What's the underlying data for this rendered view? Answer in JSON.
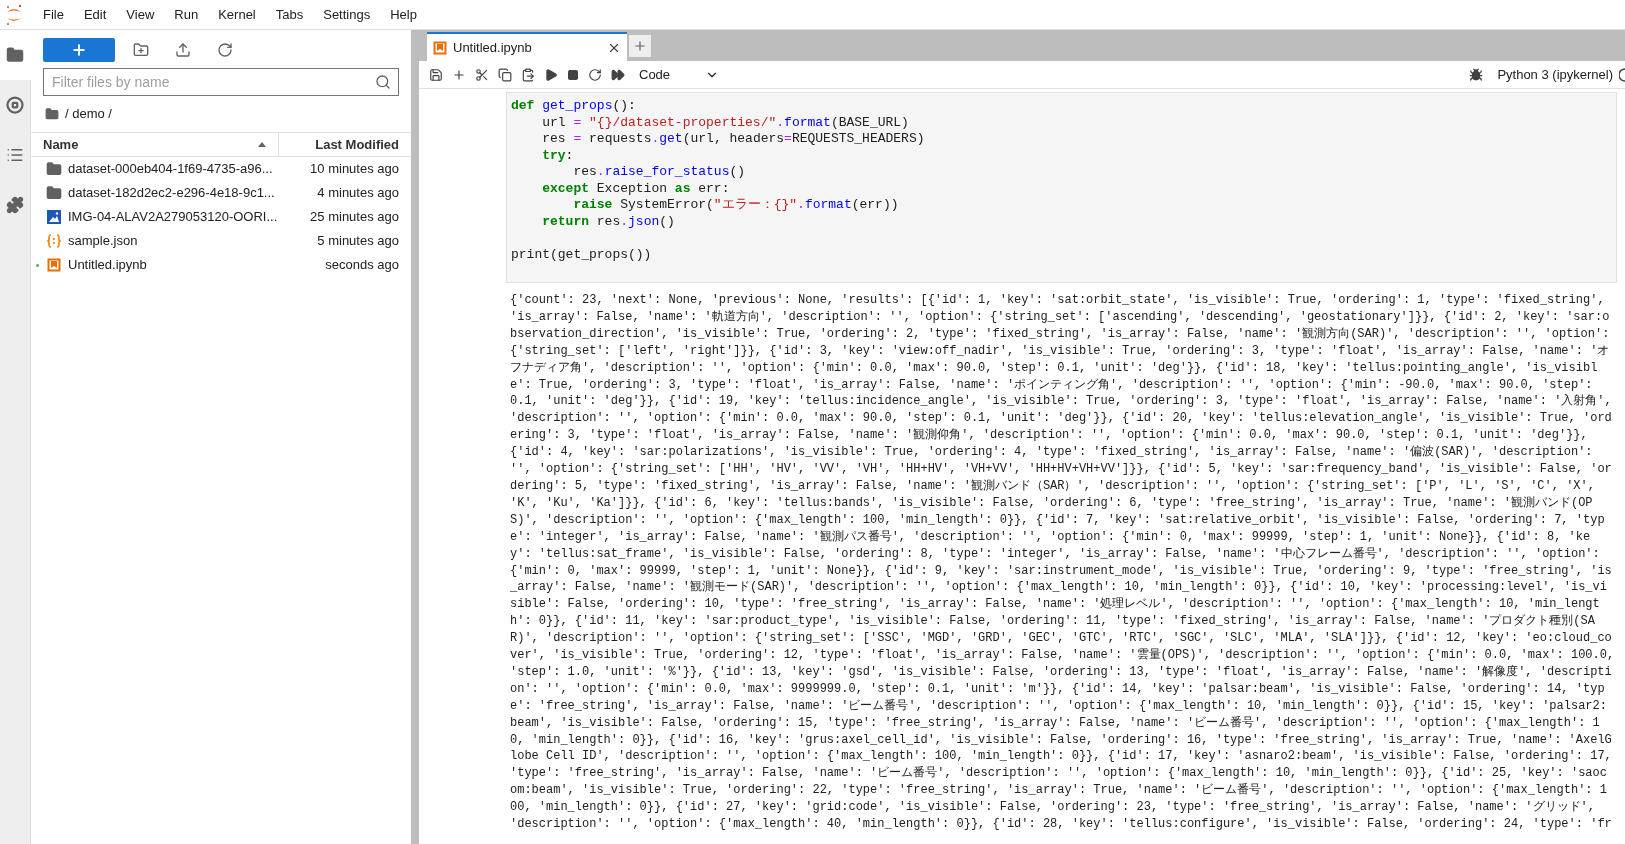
{
  "menu": [
    "File",
    "Edit",
    "View",
    "Run",
    "Kernel",
    "Tabs",
    "Settings",
    "Help"
  ],
  "file_browser": {
    "filter_placeholder": "Filter files by name",
    "breadcrumb": "/ demo /",
    "columns": [
      "Name",
      "Last Modified"
    ],
    "files": [
      {
        "name": "dataset-000eb404-1f69-4735-a96...",
        "modified": "10 minutes ago",
        "kind": "folder",
        "running": false
      },
      {
        "name": "dataset-182d2ec2-e296-4e18-9c1...",
        "modified": "4 minutes ago",
        "kind": "folder",
        "running": false
      },
      {
        "name": "IMG-04-ALAV2A279053120-OORI...",
        "modified": "25 minutes ago",
        "kind": "image",
        "running": false
      },
      {
        "name": "sample.json",
        "modified": "5 minutes ago",
        "kind": "json",
        "running": false
      },
      {
        "name": "Untitled.ipynb",
        "modified": "seconds ago",
        "kind": "notebook",
        "running": true
      }
    ]
  },
  "notebook": {
    "tab": {
      "title": "Untitled.ipynb"
    },
    "cell_type": "Code",
    "kernel": "Python 3 (ipykernel)",
    "code_blocks": [
      [
        [
          {
            "text": "def ",
            "kind": "keyword"
          },
          {
            "text": "get_props",
            "kind": "function"
          },
          {
            "text": "():",
            "kind": "plain"
          }
        ],
        [
          {
            "text": "    url ",
            "kind": "plain"
          },
          {
            "text": "= ",
            "kind": "operator"
          },
          {
            "text": "\"{}/dataset-properties/\"",
            "kind": "string"
          },
          {
            "text": ".",
            "kind": "operator"
          },
          {
            "text": "format",
            "kind": "function"
          },
          {
            "text": "(BASE_URL)",
            "kind": "plain"
          }
        ],
        [
          {
            "text": "    res ",
            "kind": "plain"
          },
          {
            "text": "=",
            "kind": "operator"
          },
          {
            "text": " requests",
            "kind": "plain"
          },
          {
            "text": ".",
            "kind": "operator"
          },
          {
            "text": "get",
            "kind": "function"
          },
          {
            "text": "(url, headers",
            "kind": "plain"
          },
          {
            "text": "=",
            "kind": "operator"
          },
          {
            "text": "REQUESTS_HEADERS)",
            "kind": "plain"
          }
        ],
        [
          {
            "text": "    try",
            "kind": "keyword"
          },
          {
            "text": ":",
            "kind": "plain"
          }
        ],
        [
          {
            "text": "        res",
            "kind": "plain"
          },
          {
            "text": ".",
            "kind": "operator"
          },
          {
            "text": "raise_for_status",
            "kind": "function"
          },
          {
            "text": "()",
            "kind": "plain"
          }
        ],
        [
          {
            "text": "    except",
            "kind": "keyword"
          },
          {
            "text": " Exception ",
            "kind": "plain"
          },
          {
            "text": "as",
            "kind": "keyword"
          },
          {
            "text": " err:",
            "kind": "plain"
          }
        ],
        [
          {
            "text": "        raise",
            "kind": "keyword"
          },
          {
            "text": " SystemError(",
            "kind": "plain"
          },
          {
            "text": "\"エラー：{}\"",
            "kind": "string"
          },
          {
            "text": ".",
            "kind": "operator"
          },
          {
            "text": "format",
            "kind": "function"
          },
          {
            "text": "(err))",
            "kind": "plain"
          }
        ],
        [
          {
            "text": "    return",
            "kind": "keyword"
          },
          {
            "text": " res",
            "kind": "plain"
          },
          {
            "text": ".",
            "kind": "operator"
          },
          {
            "text": "json",
            "kind": "function"
          },
          {
            "text": "()",
            "kind": "plain"
          }
        ]
      ],
      [
        [
          {
            "text": "print(get_props())",
            "kind": "plain"
          }
        ]
      ]
    ],
    "output": [
      "{'count': 23, 'next': None, 'previous': None, 'results': [{'id': 1, 'key': 'sat:orbit_state', 'is_visible': True, 'ordering': 1, 'type': 'fixed_string',",
      "'is_array': False, 'name': '軌道方向', 'description': '', 'option': {'string_set': ['ascending', 'descending', 'geostationary']}}, {'id': 2, 'key': 'sar:o",
      "bservation_direction', 'is_visible': True, 'ordering': 2, 'type': 'fixed_string', 'is_array': False, 'name': '観測方向(SAR)', 'description': '', 'option':",
      "{'string_set': ['left', 'right']}}, {'id': 3, 'key': 'view:off_nadir', 'is_visible': True, 'ordering': 3, 'type': 'float', 'is_array': False, 'name': 'オ",
      "フナディア角', 'description': '', 'option': {'min': 0.0, 'max': 90.0, 'step': 0.1, 'unit': 'deg'}}, {'id': 18, 'key': 'tellus:pointing_angle', 'is_visibl",
      "e': True, 'ordering': 3, 'type': 'float', 'is_array': False, 'name': 'ポインティング角', 'description': '', 'option': {'min': -90.0, 'max': 90.0, 'step':",
      "0.1, 'unit': 'deg'}}, {'id': 19, 'key': 'tellus:incidence_angle', 'is_visible': True, 'ordering': 3, 'type': 'float', 'is_array': False, 'name': '入射角',",
      "'description': '', 'option': {'min': 0.0, 'max': 90.0, 'step': 0.1, 'unit': 'deg'}}, {'id': 20, 'key': 'tellus:elevation_angle', 'is_visible': True, 'ord",
      "ering': 3, 'type': 'float', 'is_array': False, 'name': '観測仰角', 'description': '', 'option': {'min': 0.0, 'max': 90.0, 'step': 0.1, 'unit': 'deg'}},",
      "{'id': 4, 'key': 'sar:polarizations', 'is_visible': True, 'ordering': 4, 'type': 'fixed_string', 'is_array': False, 'name': '偏波(SAR)', 'description':",
      "'', 'option': {'string_set': ['HH', 'HV', 'VV', 'VH', 'HH+HV', 'VH+VV', 'HH+HV+VH+VV']}}, {'id': 5, 'key': 'sar:frequency_band', 'is_visible': False, 'or",
      "dering': 5, 'type': 'fixed_string', 'is_array': False, 'name': '観測バンド（SAR）', 'description': '', 'option': {'string_set': ['P', 'L', 'S', 'C', 'X',",
      "'K', 'Ku', 'Ka']}}, {'id': 6, 'key': 'tellus:bands', 'is_visible': False, 'ordering': 6, 'type': 'free_string', 'is_array': True, 'name': '観測バンド(OP",
      "S)', 'description': '', 'option': {'max_length': 100, 'min_length': 0}}, {'id': 7, 'key': 'sat:relative_orbit', 'is_visible': False, 'ordering': 7, 'typ",
      "e': 'integer', 'is_array': False, 'name': '観測パス番号', 'description': '', 'option': {'min': 0, 'max': 99999, 'step': 1, 'unit': None}}, {'id': 8, 'ke",
      "y': 'tellus:sat_frame', 'is_visible': False, 'ordering': 8, 'type': 'integer', 'is_array': False, 'name': '中心フレーム番号', 'description': '', 'option':",
      "{'min': 0, 'max': 99999, 'step': 1, 'unit': None}}, {'id': 9, 'key': 'sar:instrument_mode', 'is_visible': True, 'ordering': 9, 'type': 'free_string', 'is",
      "_array': False, 'name': '観測モード(SAR)', 'description': '', 'option': {'max_length': 10, 'min_length': 0}}, {'id': 10, 'key': 'processing:level', 'is_vi",
      "sible': False, 'ordering': 10, 'type': 'free_string', 'is_array': False, 'name': '処理レベル', 'description': '', 'option': {'max_length': 10, 'min_lengt",
      "h': 0}}, {'id': 11, 'key': 'sar:product_type', 'is_visible': False, 'ordering': 11, 'type': 'fixed_string', 'is_array': False, 'name': 'プロダクト種別(SA",
      "R)', 'description': '', 'option': {'string_set': ['SSC', 'MGD', 'GRD', 'GEC', 'GTC', 'RTC', 'SGC', 'SLC', 'MLA', 'SLA']}}, {'id': 12, 'key': 'eo:cloud_co",
      "ver', 'is_visible': True, 'ordering': 12, 'type': 'float', 'is_array': False, 'name': '雲量(OPS)', 'description': '', 'option': {'min': 0.0, 'max': 100.0,",
      "'step': 1.0, 'unit': '%'}}, {'id': 13, 'key': 'gsd', 'is_visible': False, 'ordering': 13, 'type': 'float', 'is_array': False, 'name': '解像度', 'descripti",
      "on': '', 'option': {'min': 0.0, 'max': 9999999.0, 'step': 0.1, 'unit': 'm'}}, {'id': 14, 'key': 'palsar:beam', 'is_visible': False, 'ordering': 14, 'typ",
      "e': 'free_string', 'is_array': False, 'name': 'ビーム番号', 'description': '', 'option': {'max_length': 10, 'min_length': 0}}, {'id': 15, 'key': 'palsar2:",
      "beam', 'is_visible': False, 'ordering': 15, 'type': 'free_string', 'is_array': False, 'name': 'ビーム番号', 'description': '', 'option': {'max_length': 1",
      "0, 'min_length': 0}}, {'id': 16, 'key': 'grus:axel_cell_id', 'is_visible': False, 'ordering': 16, 'type': 'free_string', 'is_array': True, 'name': 'AxelG",
      "lobe Cell ID', 'description': '', 'option': {'max_length': 100, 'min_length': 0}}, {'id': 17, 'key': 'asnaro2:beam', 'is_visible': False, 'ordering': 17,",
      "'type': 'free_string', 'is_array': False, 'name': 'ビーム番号', 'description': '', 'option': {'max_length': 10, 'min_length': 0}}, {'id': 25, 'key': 'saoc",
      "om:beam', 'is_visible': True, 'ordering': 22, 'type': 'free_string', 'is_array': True, 'name': 'ビーム番号', 'description': '', 'option': {'max_length': 1",
      "00, 'min_length': 0}}, {'id': 27, 'key': 'grid:code', 'is_visible': False, 'ordering': 23, 'type': 'free_string', 'is_array': False, 'name': 'グリッド',",
      "'description': '', 'option': {'max_length': 40, 'min_length': 0}}, {'id': 28, 'key': 'tellus:configure', 'is_visible': False, 'ordering': 24, 'type': 'fr"
    ]
  }
}
